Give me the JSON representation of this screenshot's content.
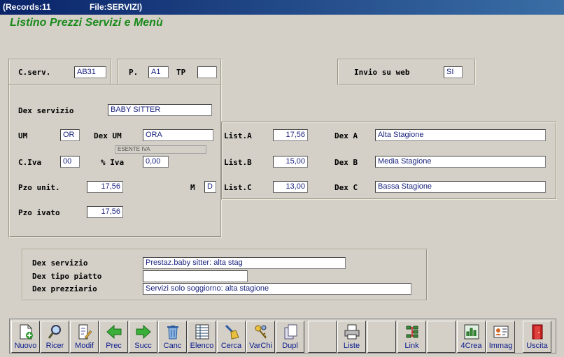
{
  "window": {
    "records": "(Records:11",
    "file": "File:SERVIZI)"
  },
  "heading": "Listino Prezzi Servizi e Menù",
  "top": {
    "cserv_label": "C.serv.",
    "cserv_value": "AB31",
    "p_label": "P.",
    "p_value": "A1",
    "tp_label": "TP",
    "tp_value": "",
    "invio_label": "Invio su web",
    "invio_value": "SI"
  },
  "main": {
    "dex_servizio_label": "Dex servizio",
    "dex_servizio_value": "BABY SITTER",
    "um_label": "UM",
    "um_value": "OR",
    "dex_um_label": "Dex UM",
    "dex_um_value": "ORA",
    "iva_desc": "ESENTE IVA",
    "civa_label": "C.Iva",
    "civa_value": "00",
    "piva_label": "% Iva",
    "piva_value": "0,00",
    "pzo_unit_label": "Pzo unit.",
    "pzo_unit_value": "17,56",
    "m_label": "M",
    "m_value": "D",
    "pzo_ivato_label": "Pzo ivato",
    "pzo_ivato_value": "17,56"
  },
  "listini": [
    {
      "label": "List.A",
      "value": "17,56",
      "dex_label": "Dex A",
      "dex_value": "Alta Stagione"
    },
    {
      "label": "List.B",
      "value": "15,00",
      "dex_label": "Dex B",
      "dex_value": "Media Stagione"
    },
    {
      "label": "List.C",
      "value": "13,00",
      "dex_label": "Dex C",
      "dex_value": "Bassa Stagione"
    }
  ],
  "bottom": {
    "dex_servizio_label": "Dex servizio",
    "dex_servizio_value": "Prestaz.baby sitter: alta stag",
    "dex_tipo_label": "Dex tipo piatto",
    "dex_tipo_value": "",
    "dex_prezz_label": "Dex prezziario",
    "dex_prezz_value": "Servizi solo soggiorno: alta stagione"
  },
  "toolbar": {
    "nuovo": "Nuovo",
    "ricer": "Ricer",
    "modif": "Modif",
    "prec": "Prec",
    "succ": "Succ",
    "canc": "Canc",
    "elenco": "Elenco",
    "cerca": "Cerca",
    "varchi": "VarChi",
    "dupl": "Dupl",
    "liste": "Liste",
    "link": "Link",
    "crea": "4Crea",
    "immag": "Immag",
    "uscita": "Uscita"
  },
  "colors": {
    "heading": "#1b8a1b",
    "field_text": "#1a237e",
    "toolbar_text": "#0a1a8a",
    "titlebar": "#0a246a"
  }
}
